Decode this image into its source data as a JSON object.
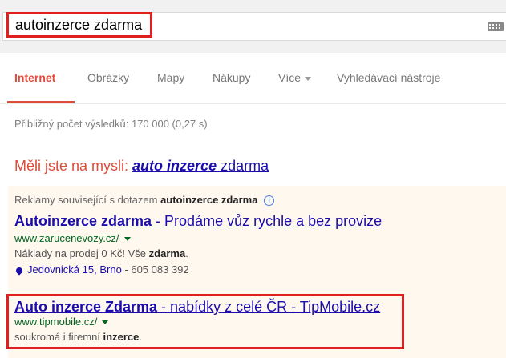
{
  "search": {
    "query": "autoinzerce zdarma",
    "keyboard_icon": "keyboard-icon"
  },
  "tabs": [
    {
      "label": "Internet",
      "active": true
    },
    {
      "label": "Obrázky"
    },
    {
      "label": "Mapy"
    },
    {
      "label": "Nákupy"
    },
    {
      "label": "Více"
    },
    {
      "label": "Vyhledávací nástroje"
    }
  ],
  "stats": "Přibližný počet výsledků: 170 000 (0,27 s)",
  "did_you_mean": {
    "label": "Měli jste na mysli:",
    "suggestion_bold": "auto inzerce",
    "suggestion_rest": "zdarma"
  },
  "ads": {
    "header_prefix": "Reklamy související s dotazem",
    "header_query": "autoinzerce zdarma",
    "items": [
      {
        "title_bold": "Autoinzerce zdarma",
        "title_rest": " - Prodáme vůz rychle a bez provize",
        "url": "www.zarucenevozy.cz/",
        "desc_prefix": "Náklady na prodej 0 Kč! Vše ",
        "desc_bold": "zdarma",
        "desc_suffix": ".",
        "address": "Jedovnická 15, Brno",
        "phone": " - 605 083 392"
      },
      {
        "title_bold": "Auto inzerce Zdarma",
        "title_rest": " - nabídky z celé ČR - TipMobile.cz",
        "url": "www.tipmobile.cz/",
        "desc_prefix": "soukromá i firemní ",
        "desc_bold": "inzerce",
        "desc_suffix": "."
      }
    ]
  },
  "colors": {
    "accent_red": "#dd4b39",
    "link_blue": "#1a0dab",
    "url_green": "#006621",
    "ad_background": "#fff8ef",
    "highlight_box": "#e02020"
  }
}
